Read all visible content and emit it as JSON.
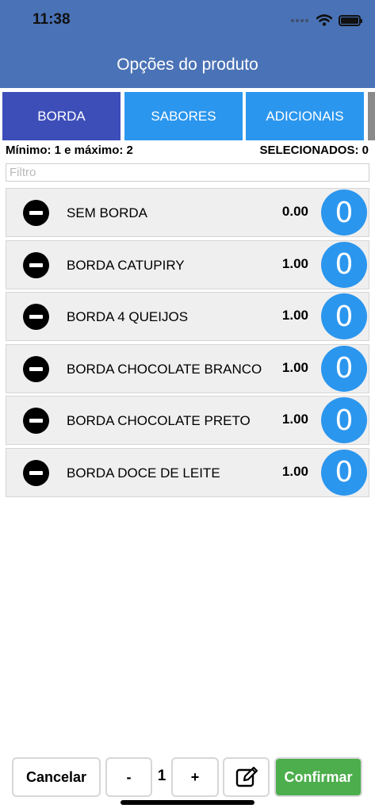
{
  "status_bar": {
    "time": "11:38",
    "icons": [
      "signal-dots-icon",
      "wifi-icon",
      "battery-icon"
    ]
  },
  "header": {
    "title": "Opções do produto",
    "color": "#4a72b6"
  },
  "tabs": [
    {
      "label": "BORDA",
      "active": true
    },
    {
      "label": "SABORES",
      "active": false
    },
    {
      "label": "ADICIONAIS",
      "active": false
    }
  ],
  "limits": {
    "text": "Mínimo: 1 e máximo: 2",
    "selected_text": "SELECIONADOS: 0"
  },
  "filter": {
    "placeholder": "Filtro",
    "value": ""
  },
  "items": [
    {
      "name": "SEM BORDA",
      "price": "0.00",
      "qty": "0",
      "icon": "minus-circle-icon"
    },
    {
      "name": "BORDA CATUPIRY",
      "price": "1.00",
      "qty": "0",
      "icon": "minus-circle-icon"
    },
    {
      "name": "BORDA 4 QUEIJOS",
      "price": "1.00",
      "qty": "0",
      "icon": "minus-circle-icon"
    },
    {
      "name": "BORDA CHOCOLATE BRANCO",
      "price": "1.00",
      "qty": "0",
      "icon": "minus-circle-icon"
    },
    {
      "name": "BORDA CHOCOLATE PRETO",
      "price": "1.00",
      "qty": "0",
      "icon": "minus-circle-icon"
    },
    {
      "name": "BORDA DOCE DE LEITE",
      "price": "1.00",
      "qty": "0",
      "icon": "minus-circle-icon"
    }
  ],
  "footer": {
    "cancel_label": "Cancelar",
    "decrement_label": "-",
    "quantity": "1",
    "increment_label": "+",
    "notes_icon": "edit-note-icon",
    "confirm_label": "Confirmar"
  },
  "colors": {
    "tab_active": "#3d4eb9",
    "tab": "#2b96ee",
    "confirm": "#4cae4c",
    "qty_bubble": "#2b96ee"
  }
}
